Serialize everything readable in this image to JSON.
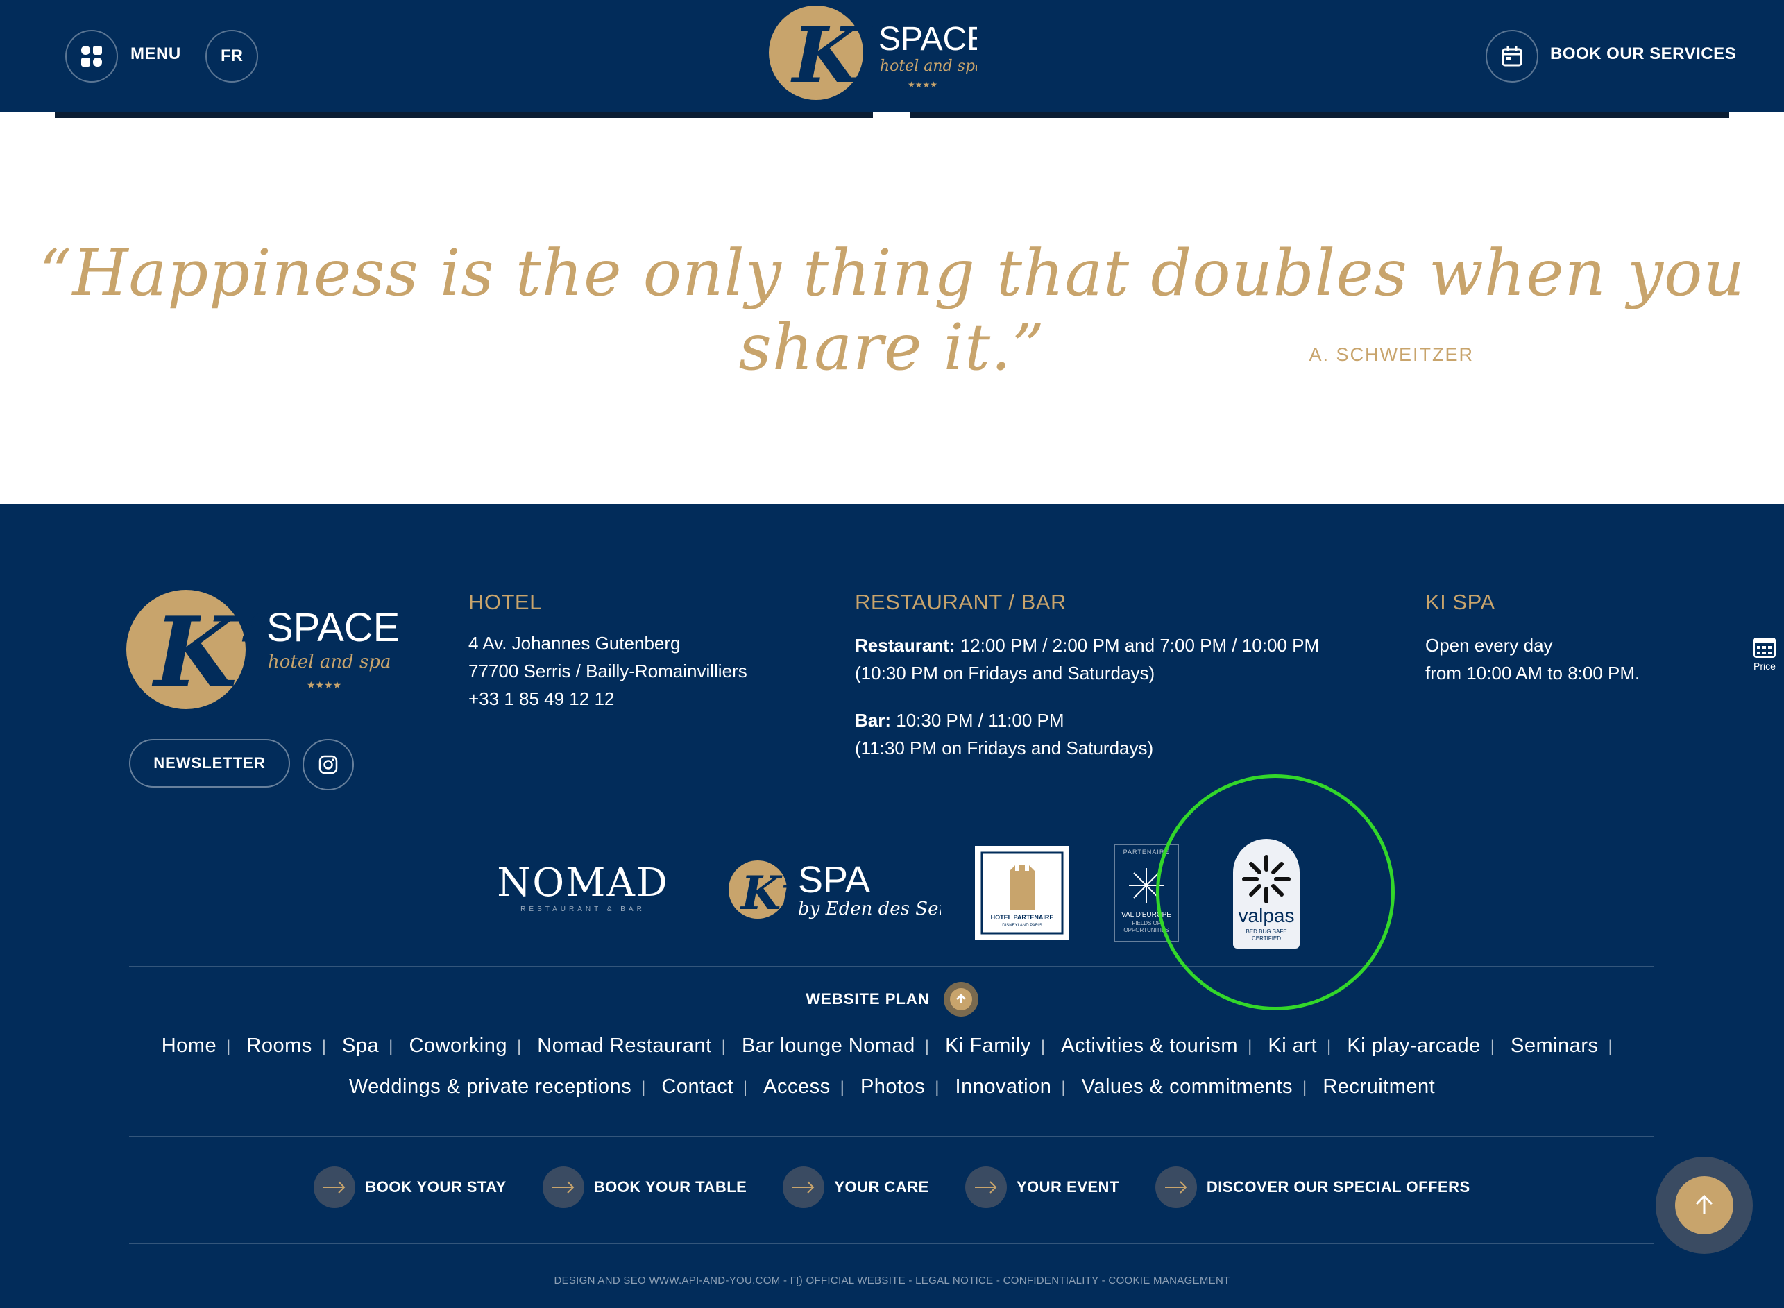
{
  "header": {
    "menu_label": "MENU",
    "lang_label": "FR",
    "book_label": "BOOK OUR SERVICES",
    "brand": {
      "ki": "Ki",
      "name": "SPACE",
      "tagline": "hotel and spa",
      "stars": "★★★★"
    }
  },
  "quote": {
    "text": "“Happiness is the only thing that doubles when you share it.”",
    "author": "A. SCHWEITZER"
  },
  "footer": {
    "brand": {
      "ki": "Ki",
      "name": "SPACE",
      "tagline": "hotel and spa",
      "stars": "★★★★"
    },
    "newsletter_label": "NEWSLETTER",
    "hotel": {
      "title": "HOTEL",
      "address1": "4 Av. Johannes Gutenberg",
      "address2": "77700  Serris / Bailly-Romainvilliers",
      "phone": "+33 1 85 49 12 12"
    },
    "restaurant": {
      "title": "RESTAURANT / BAR",
      "restaurant_label": "Restaurant:",
      "restaurant_hours": " 12:00 PM / 2:00 PM and 7:00 PM / 10:00 PM",
      "restaurant_note": "(10:30 PM on Fridays and Saturdays)",
      "bar_label": "Bar:",
      "bar_hours": " 10:30 PM / 11:00 PM",
      "bar_note": "(11:30 PM on Fridays and Saturdays)"
    },
    "spa": {
      "title": "KI SPA",
      "line1": "Open every day",
      "line2": "from 10:00 AM to 8:00 PM."
    },
    "price_tab_label": "Price",
    "partners": {
      "nomad": {
        "name": "NOMAD",
        "sub": "RESTAURANT & BAR"
      },
      "kispa": {
        "ki": "Ki",
        "name": "SPA",
        "sub": "by Eden des Sens"
      },
      "disney": {
        "line1": "HOTEL PARTENAIRE",
        "line2": "DISNEYLAND PARIS"
      },
      "valeurope": {
        "top": "PARTENAIRE",
        "line1": "VAL D'EUROPE",
        "line2": "FIELDS OF",
        "line3": "OPPORTUNITIES"
      },
      "valpas": {
        "name": "valpas",
        "sub1": "BED BUG SAFE",
        "sub2": "CERTIFIED"
      }
    },
    "website_plan_label": "WEBSITE PLAN",
    "links_row1": [
      "Home",
      "Rooms",
      "Spa",
      "Coworking",
      "Nomad Restaurant",
      "Bar lounge Nomad",
      "Ki Family",
      "Activities & tourism",
      "Ki art",
      "Ki play-arcade",
      "Seminars"
    ],
    "links_row2": [
      "Weddings & private receptions",
      "Contact",
      "Access",
      "Photos",
      "Innovation",
      "Values & commitments",
      "Recruitment"
    ],
    "link_separator": "|",
    "cta": [
      "BOOK YOUR STAY",
      "BOOK YOUR TABLE",
      "YOUR CARE",
      "YOUR EVENT",
      "DISCOVER OUR SPECIAL OFFERS"
    ],
    "legal": "DESIGN AND SEO WWW.API-AND-YOU.COM - ΓĮ) OFFICIAL WEBSITE - LEGAL NOTICE - CONFIDENTIALITY - COOKIE MANAGEMENT"
  },
  "colors": {
    "navy": "#022c5a",
    "gold": "#c8a46c",
    "highlight": "#33d72a"
  }
}
